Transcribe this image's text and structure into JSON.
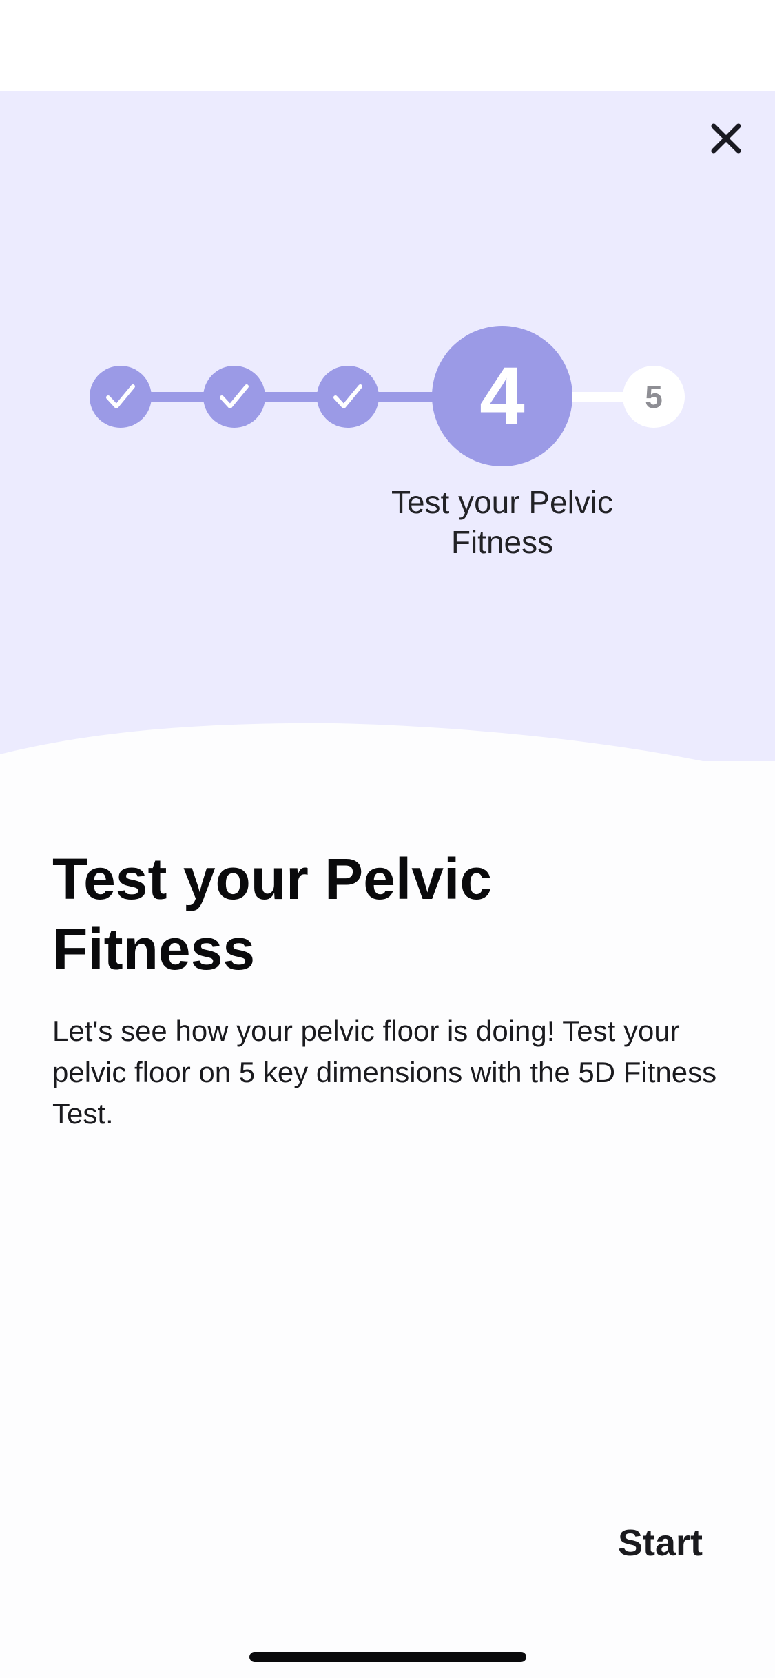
{
  "stepper": {
    "steps": [
      {
        "state": "done",
        "icon": "check-icon"
      },
      {
        "state": "done",
        "icon": "check-icon"
      },
      {
        "state": "done",
        "icon": "check-icon"
      },
      {
        "state": "current",
        "number": "4"
      },
      {
        "state": "upcoming",
        "number": "5"
      }
    ],
    "current_label": "Test your Pelvic Fitness"
  },
  "content": {
    "title": "Test your Pelvic Fitness",
    "description": "Let's see how your pelvic floor is doing! Test your pelvic floor on 5 key dimensions with the 5D Fitness Test."
  },
  "actions": {
    "start_label": "Start",
    "close_icon": "close-icon"
  },
  "colors": {
    "hero_background": "#ECEBFE",
    "accent": "#9B9AE6",
    "upcoming_step": "#FFFFFF",
    "text": "#0A0A0C"
  }
}
